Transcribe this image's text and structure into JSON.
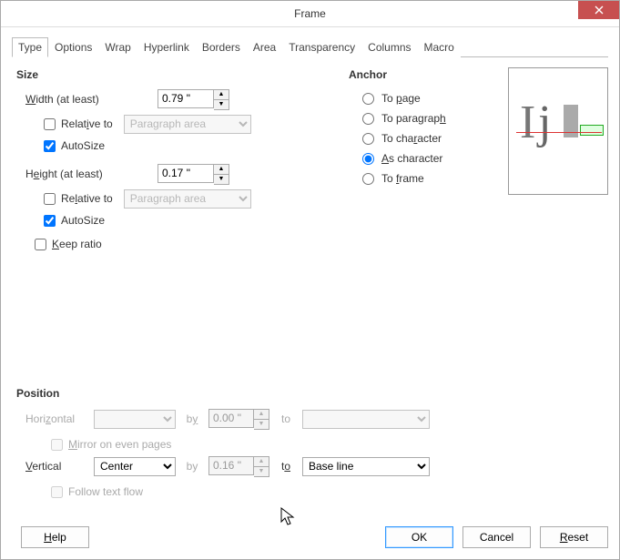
{
  "window": {
    "title": "Frame"
  },
  "tabs": [
    "Type",
    "Options",
    "Wrap",
    "Hyperlink",
    "Borders",
    "Area",
    "Transparency",
    "Columns",
    "Macro"
  ],
  "size": {
    "heading": "Size",
    "width_label": "idth (at least)",
    "width_value": "0.79 \"",
    "height_label": "ight (at least)",
    "height_value": "0.17 \"",
    "rel_area_option": "Paragraph area",
    "autosize_label": "AutoSize",
    "autosize_label2": "AutoSize",
    "keep_ratio": "Keep ratio",
    "width_relative_checked": false,
    "width_autosize_checked": true,
    "height_relative_checked": false,
    "height_autosize_checked": true,
    "keep_ratio_checked": false
  },
  "anchor": {
    "heading": "Anchor",
    "options": [
      "To page",
      "To paragraph",
      "To character",
      "As character",
      "To frame"
    ],
    "selected": "As character"
  },
  "position": {
    "heading": "Position",
    "horizontal_label": "Horizontal",
    "horizontal_value": "",
    "horizontal_by": "0.00 \"",
    "horizontal_to": "",
    "mirror_label": "Mirror on even pages",
    "mirror_checked": false,
    "vertical_label": "Vertical",
    "vertical_value": "Center",
    "vertical_by": "0.16 \"",
    "vertical_to": "Base line",
    "by_label": "by",
    "to_label": "to",
    "follow_text_flow": "Follow text flow",
    "follow_text_flow_checked": false
  },
  "buttons": {
    "help": "elp",
    "ok": "OK",
    "cancel": "Cancel",
    "reset": "eset"
  }
}
